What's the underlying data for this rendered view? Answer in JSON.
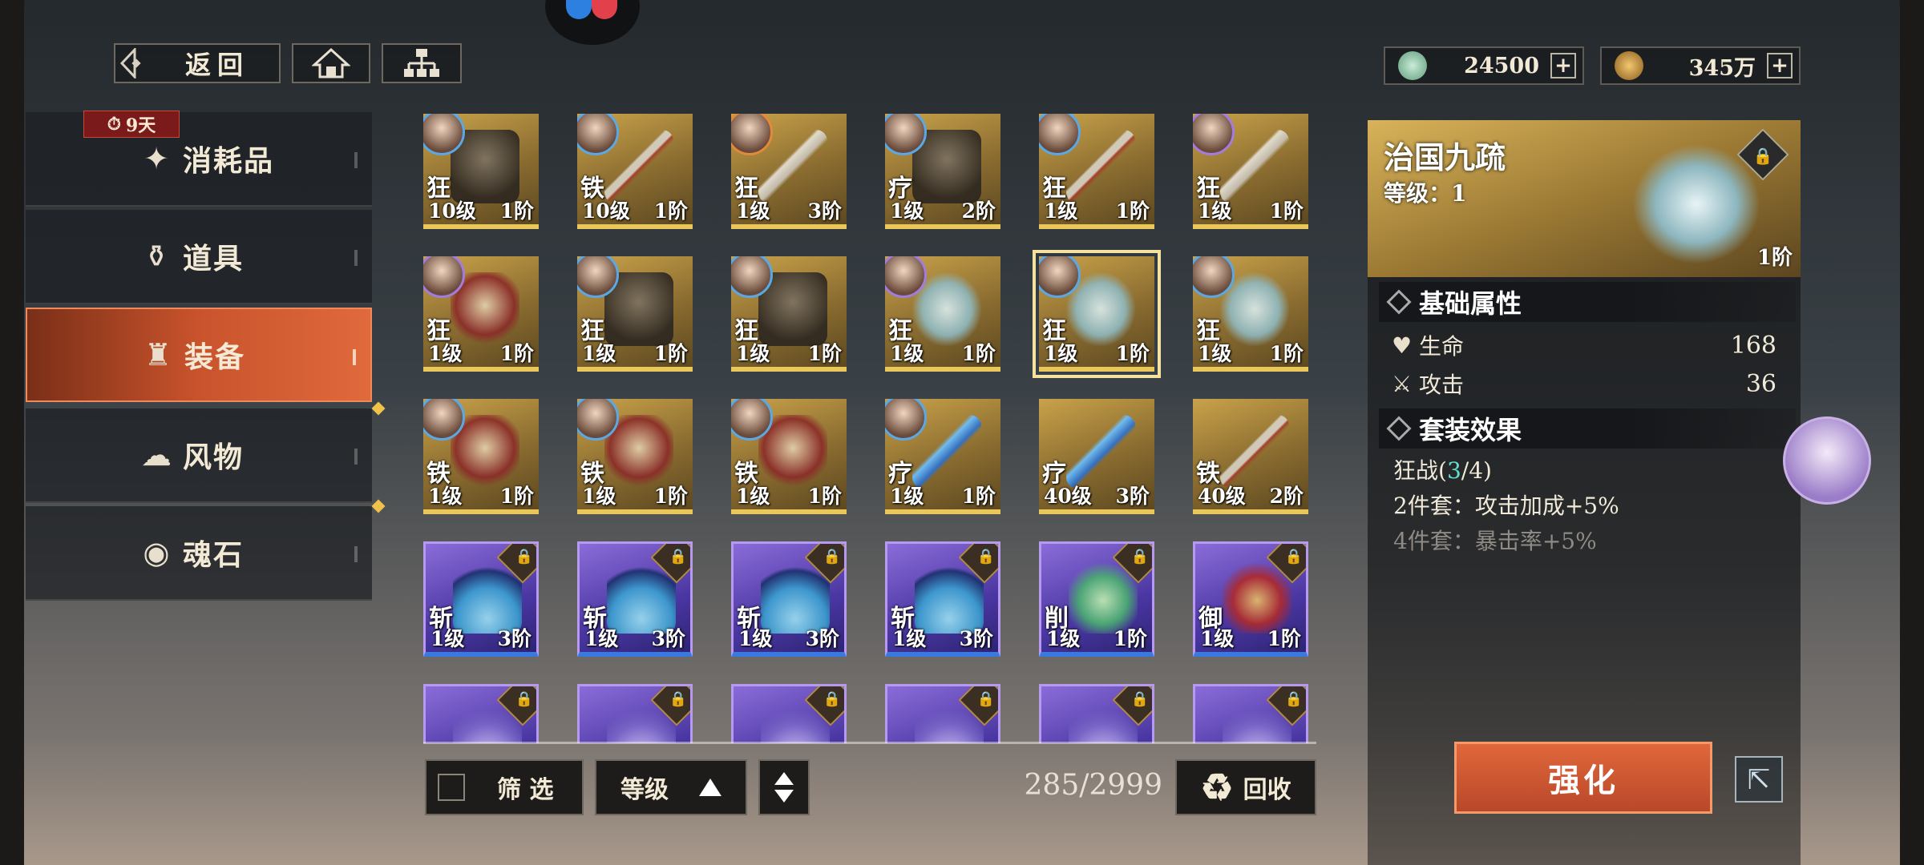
{
  "nav": {
    "back_label": "返回",
    "home_icon": "home-icon",
    "tree_icon": "hierarchy-icon"
  },
  "currency": [
    {
      "icon": "jade-coin-icon",
      "value": "24500",
      "color": "#8fc6a8"
    },
    {
      "icon": "copper-coin-icon",
      "value": "345万",
      "color": "#c9953a"
    }
  ],
  "timer_badge": "9天",
  "sidebar": {
    "items": [
      {
        "label": "消耗品",
        "icon": "consumable-icon"
      },
      {
        "label": "道具",
        "icon": "bag-icon"
      },
      {
        "label": "装备",
        "icon": "armor-icon",
        "active": true
      },
      {
        "label": "风物",
        "icon": "scenery-icon"
      },
      {
        "label": "魂石",
        "icon": "soul-stone-icon"
      }
    ]
  },
  "grid": {
    "rows": [
      [
        {
          "type": "狂",
          "level": "10级",
          "rank": "1阶",
          "art": "armor",
          "avatar": "b"
        },
        {
          "type": "铁",
          "level": "10级",
          "rank": "1阶",
          "art": "spear",
          "avatar": "b"
        },
        {
          "type": "狂",
          "level": "1级",
          "rank": "3阶",
          "art": "sword",
          "avatar": "o"
        },
        {
          "type": "疗",
          "level": "1级",
          "rank": "2阶",
          "art": "armor",
          "avatar": "b"
        },
        {
          "type": "狂",
          "level": "1级",
          "rank": "1阶",
          "art": "spear",
          "avatar": "b"
        },
        {
          "type": "狂",
          "level": "1级",
          "rank": "1阶",
          "art": "sword",
          "avatar": "p"
        }
      ],
      [
        {
          "type": "狂",
          "level": "1级",
          "rank": "1阶",
          "art": "helmet",
          "avatar": "p"
        },
        {
          "type": "狂",
          "level": "1级",
          "rank": "1阶",
          "art": "armor",
          "avatar": "b"
        },
        {
          "type": "狂",
          "level": "1级",
          "rank": "1阶",
          "art": "armor",
          "avatar": "b"
        },
        {
          "type": "狂",
          "level": "1级",
          "rank": "1阶",
          "art": "scroll",
          "avatar": "p"
        },
        {
          "type": "狂",
          "level": "1级",
          "rank": "1阶",
          "art": "scroll",
          "avatar": "b",
          "selected": true
        },
        {
          "type": "狂",
          "level": "1级",
          "rank": "1阶",
          "art": "scroll",
          "avatar": "b"
        }
      ],
      [
        {
          "type": "铁",
          "level": "1级",
          "rank": "1阶",
          "art": "helmet",
          "avatar": "b"
        },
        {
          "type": "铁",
          "level": "1级",
          "rank": "1阶",
          "art": "helmet",
          "avatar": "b"
        },
        {
          "type": "铁",
          "level": "1级",
          "rank": "1阶",
          "art": "helmet",
          "avatar": "b"
        },
        {
          "type": "疗",
          "level": "1级",
          "rank": "1阶",
          "art": "blade",
          "avatar": "b"
        },
        {
          "type": "疗",
          "level": "40级",
          "rank": "3阶",
          "art": "blade"
        },
        {
          "type": "铁",
          "level": "40级",
          "rank": "2阶",
          "art": "spear"
        }
      ],
      [
        {
          "type": "斩",
          "level": "1级",
          "rank": "3阶",
          "art": "fan",
          "locked": true,
          "purple": true
        },
        {
          "type": "斩",
          "level": "1级",
          "rank": "3阶",
          "art": "fan",
          "locked": true,
          "purple": true
        },
        {
          "type": "斩",
          "level": "1级",
          "rank": "3阶",
          "art": "fan",
          "locked": true,
          "purple": true
        },
        {
          "type": "斩",
          "level": "1级",
          "rank": "3阶",
          "art": "fan",
          "locked": true,
          "purple": true
        },
        {
          "type": "削",
          "level": "1级",
          "rank": "1阶",
          "art": "jade",
          "locked": true,
          "purple": true
        },
        {
          "type": "御",
          "level": "1级",
          "rank": "1阶",
          "art": "crown",
          "locked": true,
          "purple": true
        }
      ],
      [
        {
          "art": "misc",
          "locked": true,
          "purple": true
        },
        {
          "art": "misc",
          "locked": true,
          "purple": true
        },
        {
          "art": "misc",
          "locked": true,
          "purple": true
        },
        {
          "art": "misc",
          "locked": true,
          "purple": true
        },
        {
          "art": "misc",
          "locked": true,
          "purple": true
        },
        {
          "art": "misc",
          "locked": true,
          "purple": true
        }
      ]
    ]
  },
  "bottom": {
    "filter_label": "筛 选",
    "sort_label": "等级",
    "count": "285/2999",
    "recycle_label": "回收"
  },
  "detail": {
    "name": "治国九疏",
    "level_text": "等级：1",
    "rank": "1阶",
    "base_header": "基础属性",
    "stats": [
      {
        "icon": "heart-icon",
        "label": "生命",
        "value": "168"
      },
      {
        "icon": "sword-icon",
        "label": "攻击",
        "value": "36"
      }
    ],
    "set_header": "套装效果",
    "set_name": "狂战(",
    "set_count_hl": "3",
    "set_total": "/4)",
    "set2": "2件套：攻击加成+5%",
    "set4": "4件套：暴击率+5%",
    "enhance_label": "强化"
  }
}
